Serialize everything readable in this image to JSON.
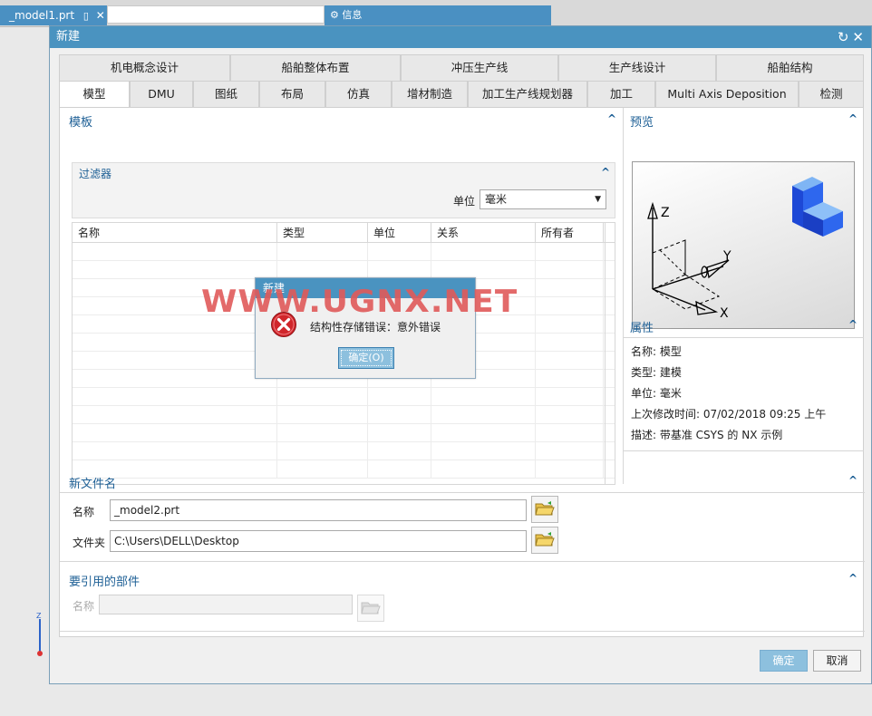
{
  "app": {
    "file_tab": "_model1.prt",
    "info_tab": "信息"
  },
  "dialog": {
    "title": "新建"
  },
  "tabs_row1": [
    "机电概念设计",
    "船舶整体布置",
    "冲压生产线",
    "生产线设计",
    "船舶结构"
  ],
  "tabs_row2": [
    "模型",
    "DMU",
    "图纸",
    "布局",
    "仿真",
    "增材制造",
    "加工生产线规划器",
    "加工",
    "Multi Axis Deposition",
    "检测"
  ],
  "template": {
    "header": "模板",
    "filter": {
      "header": "过滤器",
      "unit_label": "单位",
      "unit_value": "毫米"
    },
    "columns": [
      "名称",
      "类型",
      "单位",
      "关系",
      "所有者"
    ]
  },
  "preview": {
    "header": "预览",
    "axis_z": "Z",
    "axis_y": "Y",
    "axis_x": "X"
  },
  "properties": {
    "header": "属性",
    "name": "名称:  模型",
    "type": "类型:  建模",
    "unit": "单位:  毫米",
    "modified": "上次修改时间:   07/02/2018 09:25 上午",
    "description": "描述:  带基准 CSYS 的 NX 示例"
  },
  "new_file": {
    "header": "新文件名",
    "name_label": "名称",
    "name_value": "_model2.prt",
    "folder_label": "文件夹",
    "folder_value": "C:\\Users\\DELL\\Desktop"
  },
  "referenced": {
    "header": "要引用的部件",
    "name_label": "名称",
    "name_value": ""
  },
  "buttons": {
    "ok": "确定",
    "cancel": "取消"
  },
  "error_dialog": {
    "title": "新建",
    "message": "结构性存储错误：意外错误",
    "ok": "确定(O)"
  },
  "watermark": "WWW.UGNX.NET",
  "colors": {
    "title_bar": "#4a93c0",
    "section_header": "#1d5f95",
    "ok_button": "#8dc0de",
    "error_icon": "#d0262b"
  }
}
